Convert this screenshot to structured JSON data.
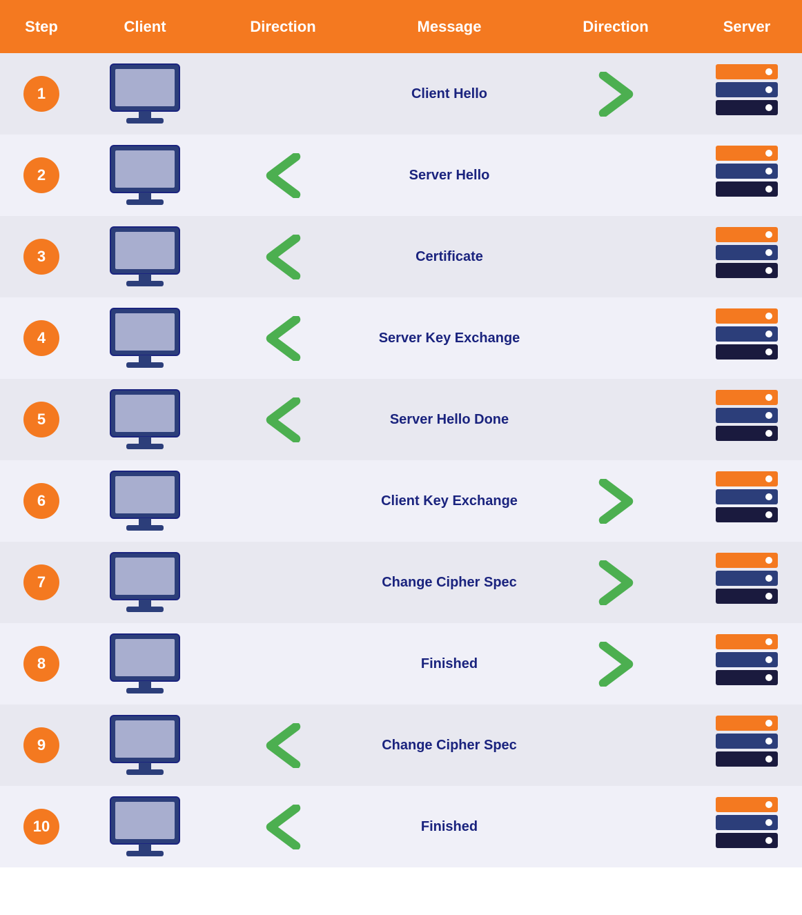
{
  "header": {
    "col1": "Step",
    "col2": "Client",
    "col3": "Direction",
    "col4": "Message",
    "col5": "Direction",
    "col6": "Server"
  },
  "rows": [
    {
      "step": "1",
      "message": "Client Hello",
      "client_direction": "",
      "server_direction": "right"
    },
    {
      "step": "2",
      "message": "Server Hello",
      "client_direction": "left",
      "server_direction": ""
    },
    {
      "step": "3",
      "message": "Certificate",
      "client_direction": "left",
      "server_direction": ""
    },
    {
      "step": "4",
      "message": "Server Key Exchange",
      "client_direction": "left",
      "server_direction": ""
    },
    {
      "step": "5",
      "message": "Server Hello Done",
      "client_direction": "left",
      "server_direction": ""
    },
    {
      "step": "6",
      "message": "Client Key Exchange",
      "client_direction": "",
      "server_direction": "right"
    },
    {
      "step": "7",
      "message": "Change Cipher Spec",
      "client_direction": "",
      "server_direction": "right"
    },
    {
      "step": "8",
      "message": "Finished",
      "client_direction": "",
      "server_direction": "right"
    },
    {
      "step": "9",
      "message": "Change Cipher Spec",
      "client_direction": "left",
      "server_direction": ""
    },
    {
      "step": "10",
      "message": "Finished",
      "client_direction": "left",
      "server_direction": ""
    }
  ],
  "colors": {
    "orange": "#F47920",
    "green": "#4CAF50",
    "dark_blue": "#1a237e",
    "row_odd": "#E8E8F0",
    "row_even": "#F0F0F8"
  }
}
